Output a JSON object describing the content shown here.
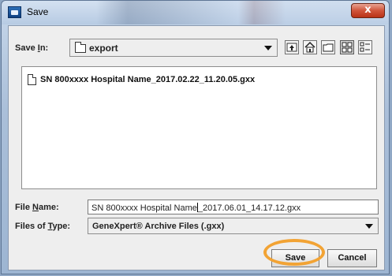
{
  "window": {
    "title": "Save",
    "close_glyph": "x"
  },
  "save_in": {
    "label_prefix": "Save ",
    "label_mnemonic": "I",
    "label_suffix": "n:",
    "folder": "export"
  },
  "toolbar": {
    "icons": [
      "up-one-level-icon",
      "home-icon",
      "new-folder-icon",
      "list-view-icon",
      "details-view-icon"
    ]
  },
  "file_list": {
    "items": [
      {
        "name": "SN 800xxxx Hospital Name_2017.02.22_11.20.05.gxx"
      }
    ]
  },
  "file_name": {
    "label_prefix": "File ",
    "label_mnemonic": "N",
    "label_suffix": "ame:",
    "value_before_caret": "SN 800xxxx Hospital Name",
    "value_after_caret": "_2017.06.01_14.17.12.gxx"
  },
  "files_of_type": {
    "label_prefix": "Files of ",
    "label_mnemonic": "T",
    "label_suffix": "ype:",
    "selected": "GeneXpert® Archive Files (.gxx)"
  },
  "buttons": {
    "save": "Save",
    "cancel": "Cancel"
  },
  "colors": {
    "highlight_ring": "#f2a334",
    "close_button": "#c94a2f"
  }
}
